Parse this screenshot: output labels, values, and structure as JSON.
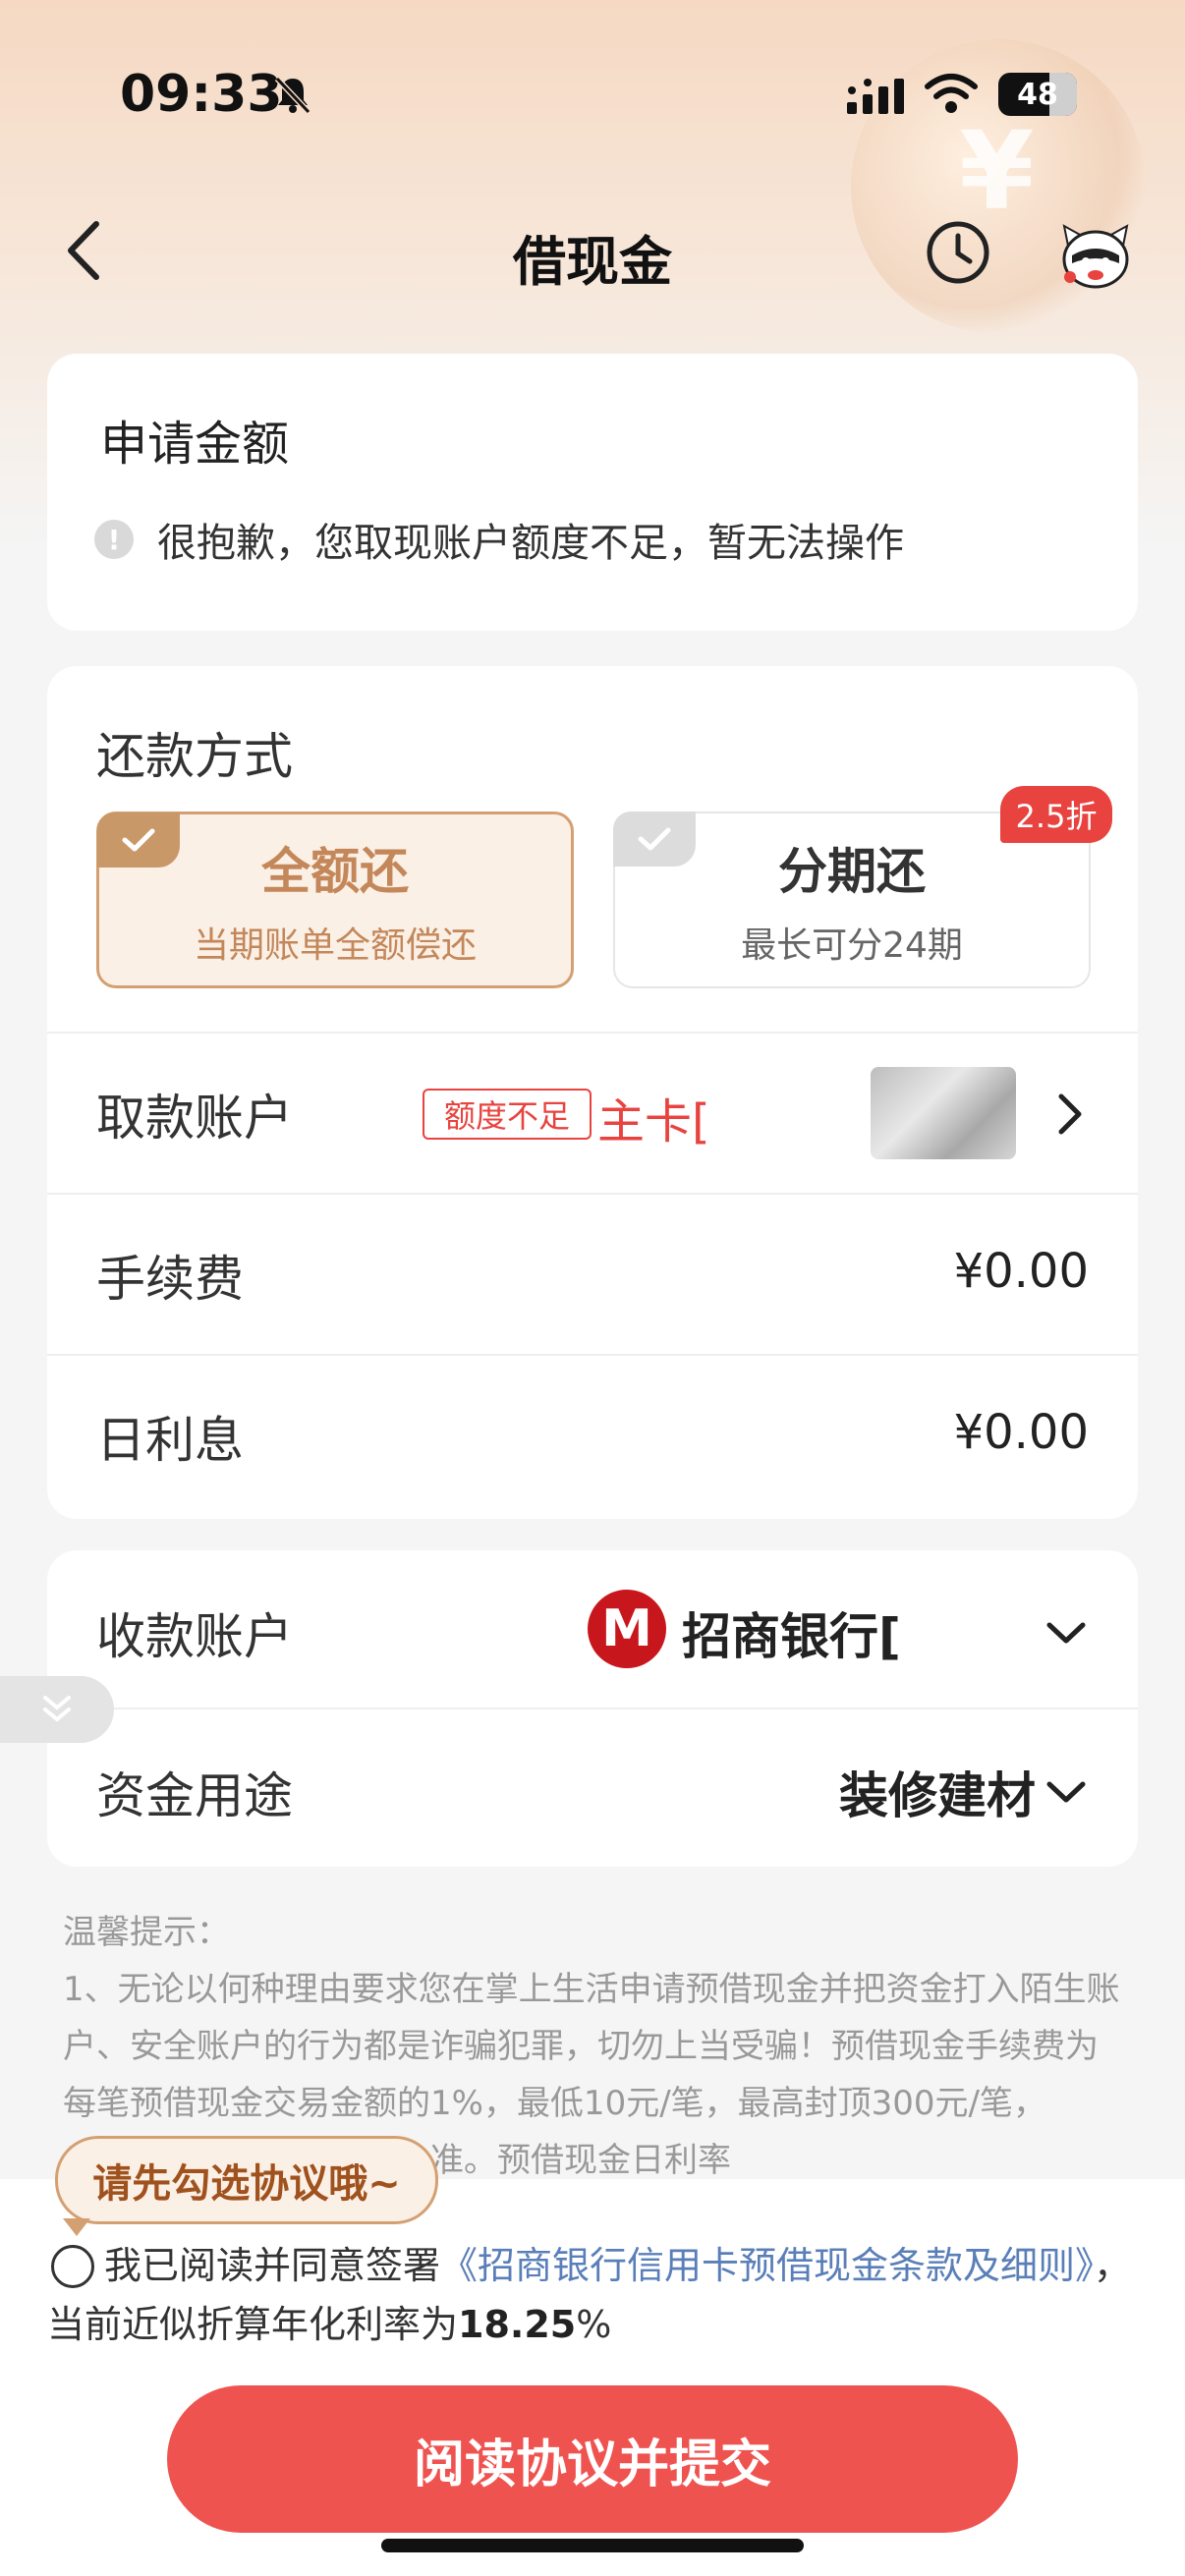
{
  "status_bar": {
    "time": "09:33",
    "battery": "48"
  },
  "nav": {
    "title": "借现金"
  },
  "apply_card": {
    "heading": "申请金额",
    "warning": "很抱歉，您取现账户额度不足，暂无法操作"
  },
  "repay": {
    "heading": "还款方式",
    "options": [
      {
        "title": "全额还",
        "subtitle": "当期账单全额偿还",
        "selected": true
      },
      {
        "title": "分期还",
        "subtitle": "最长可分24期",
        "selected": false
      }
    ],
    "badge": "2.5折"
  },
  "withdraw": {
    "label": "取款账户",
    "tag": "额度不足",
    "card_text": "主卡["
  },
  "fee": {
    "label": "手续费",
    "value": "¥0.00"
  },
  "interest": {
    "label": "日利息",
    "value": "¥0.00"
  },
  "receive": {
    "label": "收款账户",
    "bank_logo": "M",
    "bank_name": "招商银行["
  },
  "purpose": {
    "label": "资金用途",
    "value": "装修建材"
  },
  "tips": {
    "title": "温馨提示：",
    "body": "1、无论以何种理由要求您在掌上生活申请预借现金并把资金打入陌生账户、安全账户的行为都是诈骗犯罪，切勿上当受骗！预借现金手续费为每笔预借现金交易金额的1%，最低10元/笔，最高封顶300元/笔，　　　　　息，请以实际收取金额为准。预借现金日利率"
  },
  "tooltip": "请先勾选协议哦~",
  "agreement": {
    "prefix": "我已阅读并同意签署",
    "link": "《招商银行信用卡预借现金条款及细则》",
    "middle": "，当前近似折算年化利率为",
    "rate": "18.25",
    "suffix": "%"
  },
  "submit_label": "阅读协议并提交",
  "colors": {
    "accent": "#ef5350",
    "gold": "#c3875a",
    "link": "#5a7fb8"
  }
}
